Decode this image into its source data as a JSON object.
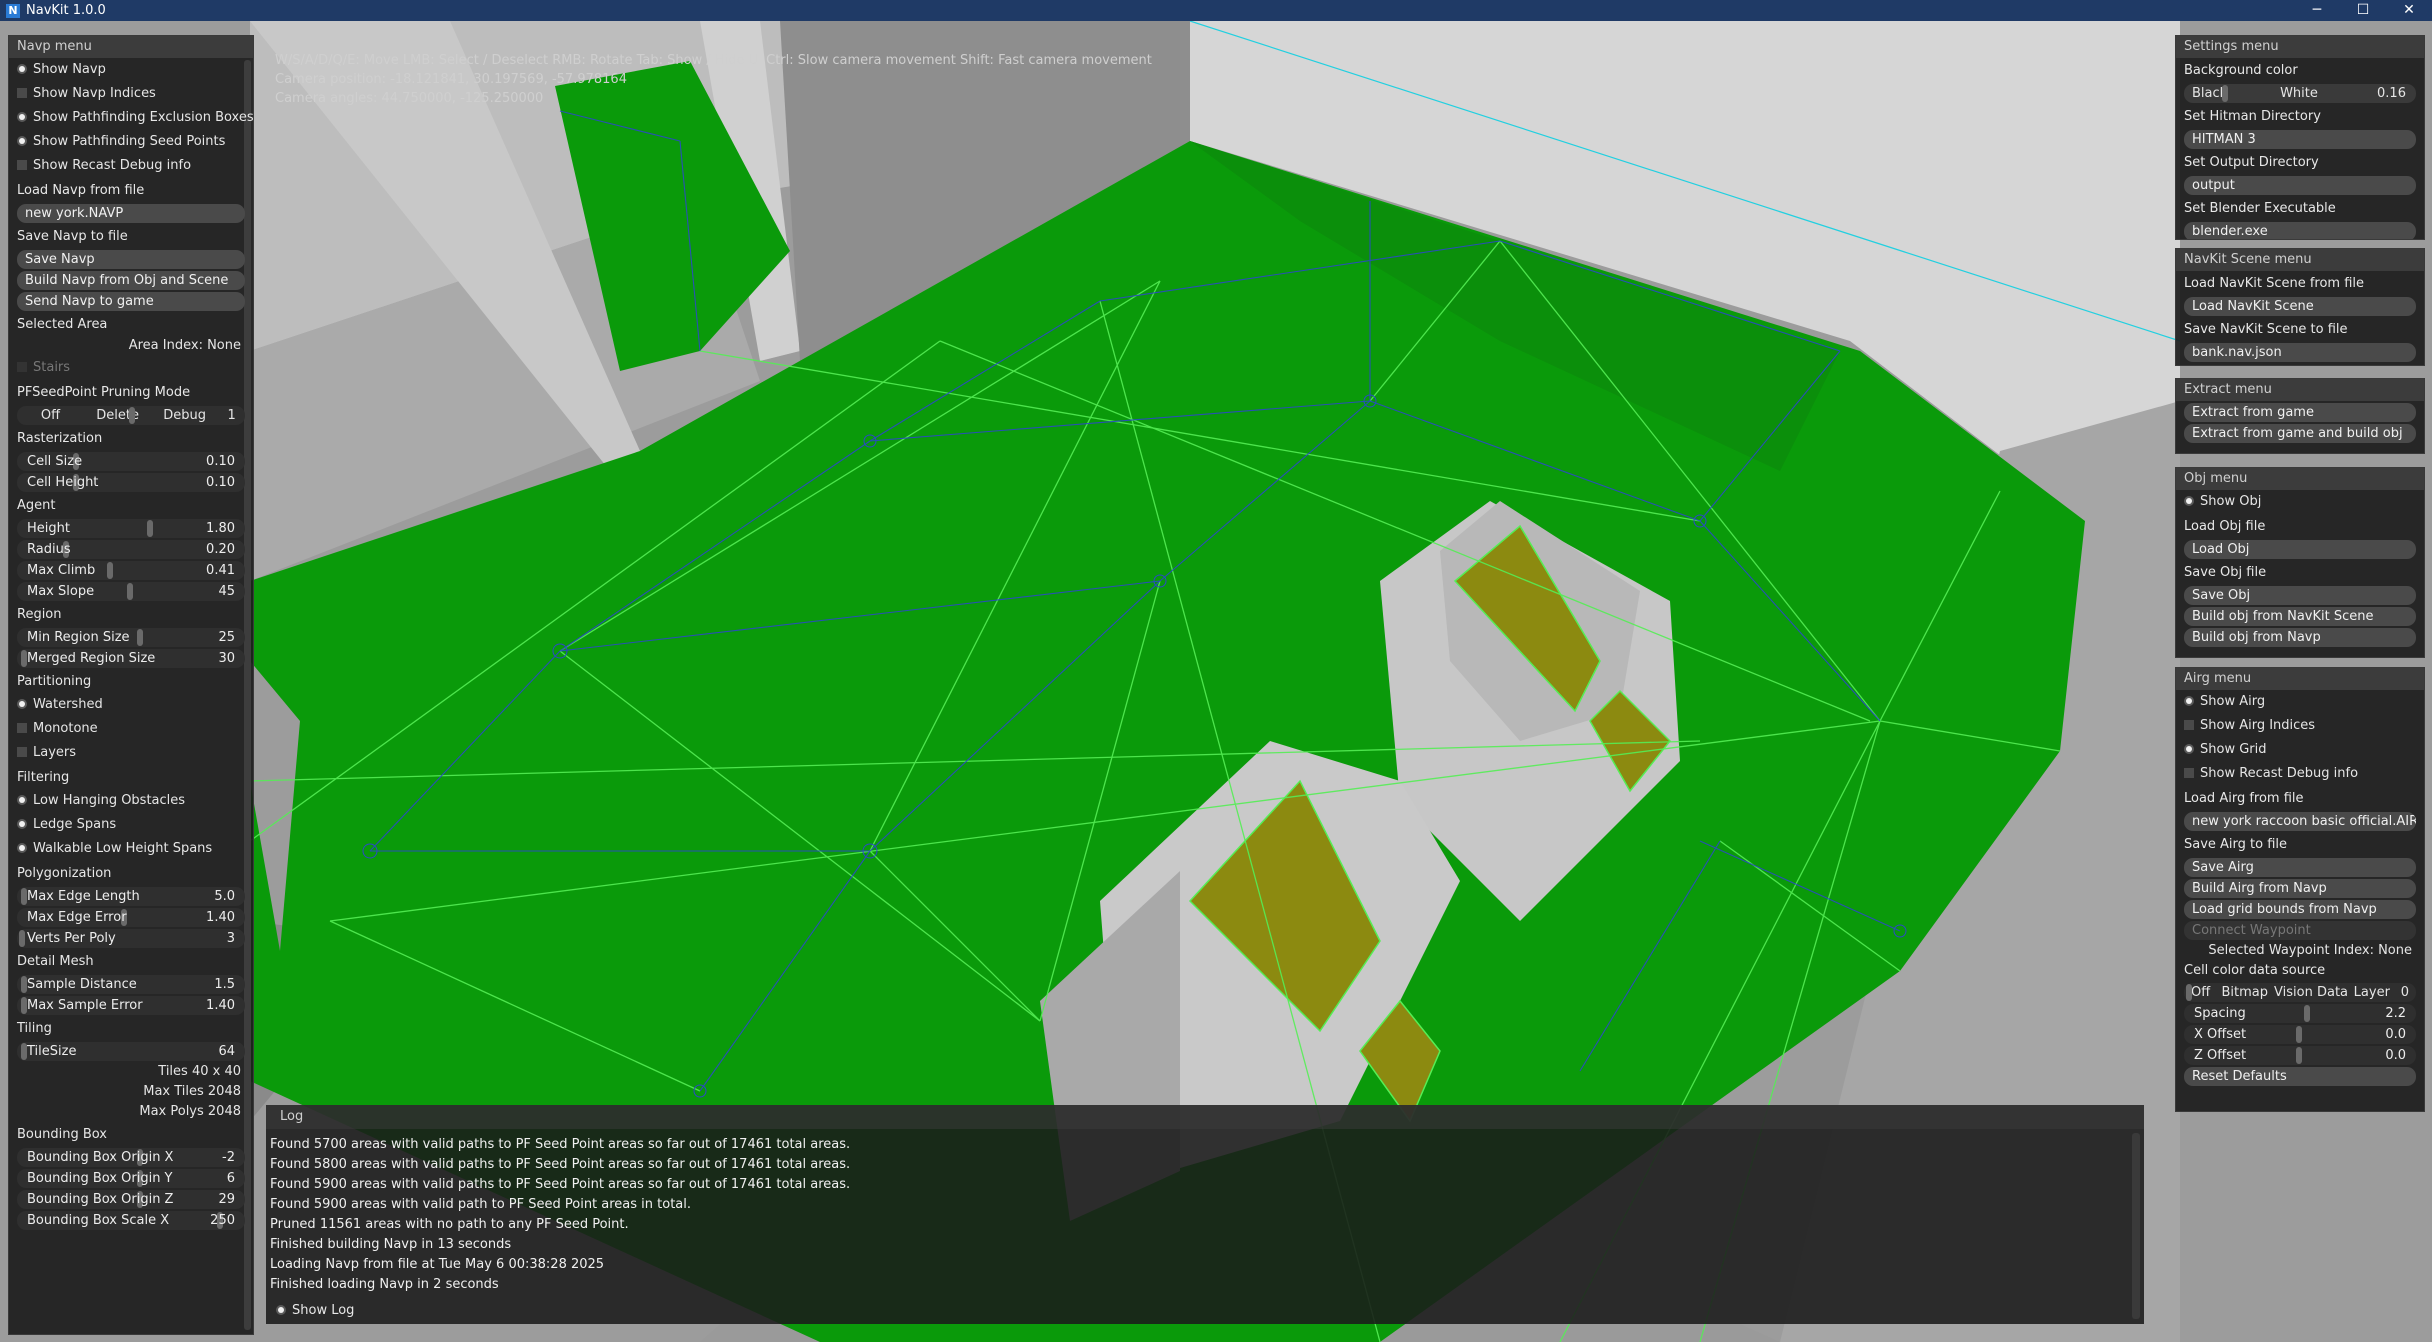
{
  "app": {
    "title": "NavKit 1.0.0",
    "logo_letter": "N"
  },
  "window_controls": {
    "minimize": "─",
    "maximize": "☐",
    "close": "✕"
  },
  "hud": {
    "controls": "W/S/A/D/Q/E: Move  LMB: Select / Deselect  RMB: Rotate  Tab: Show / Hide UI  Ctrl: Slow camera movement  Shift: Fast camera movement",
    "camera_position": "Camera position: -18.121841, 30.197569, -57.978164",
    "camera_angles": "Camera angles: 44.750000, -125.250000"
  },
  "navp_menu": {
    "title": "Navp menu",
    "show_navp": "Show Navp",
    "show_navp_indices": "Show Navp Indices",
    "show_exclusion": "Show Pathfinding Exclusion Boxes",
    "show_seed": "Show Pathfinding Seed Points",
    "show_recast": "Show Recast Debug info",
    "load_label": "Load Navp from file",
    "load_value": "new york.NAVP",
    "save_label": "Save Navp to file",
    "save_btn": "Save Navp",
    "build_btn": "Build Navp from Obj and Scene",
    "send_btn": "Send Navp to game",
    "selected_area": "Selected Area",
    "area_index": "Area Index: None",
    "stairs": "Stairs",
    "pruning_label": "PFSeedPoint Pruning Mode",
    "pruning_opts": [
      "Off",
      "Delete",
      "Debug",
      "1"
    ],
    "rasterization": "Rasterization",
    "cell_size": {
      "label": "Cell Size",
      "value": "0.10"
    },
    "cell_height": {
      "label": "Cell Height",
      "value": "0.10"
    },
    "agent": "Agent",
    "height": {
      "label": "Height",
      "value": "1.80"
    },
    "radius": {
      "label": "Radius",
      "value": "0.20"
    },
    "max_climb": {
      "label": "Max Climb",
      "value": "0.41"
    },
    "max_slope": {
      "label": "Max Slope",
      "value": "45"
    },
    "region": "Region",
    "min_region": {
      "label": "Min Region Size",
      "value": "25"
    },
    "merged_region": {
      "label": "Merged Region Size",
      "value": "30"
    },
    "partitioning": "Partitioning",
    "watershed": "Watershed",
    "monotone": "Monotone",
    "layers": "Layers",
    "filtering": "Filtering",
    "low_hanging": "Low Hanging Obstacles",
    "ledge_spans": "Ledge Spans",
    "walkable_low": "Walkable Low Height Spans",
    "polygonization": "Polygonization",
    "max_edge_len": {
      "label": "Max Edge Length",
      "value": "5.0"
    },
    "max_edge_err": {
      "label": "Max Edge Error",
      "value": "1.40"
    },
    "verts_per_poly": {
      "label": "Verts Per Poly",
      "value": "3"
    },
    "detail_mesh": "Detail Mesh",
    "sample_distance": {
      "label": "Sample Distance",
      "value": "1.5"
    },
    "max_sample_error": {
      "label": "Max Sample Error",
      "value": "1.40"
    },
    "tiling": "Tiling",
    "tile_size": {
      "label": "TileSize",
      "value": "64"
    },
    "tiles": "Tiles  40 x 40",
    "max_tiles": "Max Tiles  2048",
    "max_polys": "Max Polys  2048",
    "bounding_box": "Bounding Box",
    "bb_origin_x": {
      "label": "Bounding Box Origin X",
      "value": "-2"
    },
    "bb_origin_y": {
      "label": "Bounding Box Origin Y",
      "value": "6"
    },
    "bb_origin_z": {
      "label": "Bounding Box Origin Z",
      "value": "29"
    },
    "bb_scale_x": {
      "label": "Bounding Box Scale X",
      "value": "250"
    }
  },
  "settings_menu": {
    "title": "Settings menu",
    "bg_label": "Background color",
    "bg_black": "Black",
    "bg_white": "White",
    "bg_value": "0.16",
    "hitman_label": "Set Hitman Directory",
    "hitman_value": "HITMAN 3",
    "output_label": "Set Output Directory",
    "output_value": "output",
    "blender_label": "Set Blender Executable",
    "blender_value": "blender.exe"
  },
  "scene_menu": {
    "title": "NavKit Scene menu",
    "load_label": "Load NavKit Scene from file",
    "load_btn": "Load NavKit Scene",
    "save_label": "Save NavKit Scene to file",
    "save_value": "bank.nav.json"
  },
  "extract_menu": {
    "title": "Extract menu",
    "extract_btn": "Extract from game",
    "extract_build_btn": "Extract from game and build obj"
  },
  "obj_menu": {
    "title": "Obj menu",
    "show_obj": "Show Obj",
    "load_label": "Load Obj file",
    "load_btn": "Load Obj",
    "save_label": "Save Obj file",
    "save_btn": "Save Obj",
    "build_scene_btn": "Build obj from NavKit Scene",
    "build_navp_btn": "Build obj from Navp"
  },
  "airg_menu": {
    "title": "Airg menu",
    "show_airg": "Show Airg",
    "show_airg_indices": "Show Airg Indices",
    "show_grid": "Show Grid",
    "show_recast": "Show Recast Debug info",
    "load_label": "Load Airg from file",
    "load_value": "new york raccoon basic official.AIRG",
    "save_label": "Save Airg to file",
    "save_btn": "Save Airg",
    "build_btn": "Build Airg from Navp",
    "grid_bounds_btn": "Load grid bounds from Navp",
    "connect_btn": "Connect Waypoint",
    "selected_waypoint": "Selected Waypoint Index: None",
    "cell_color_label": "Cell color data source",
    "cell_color_opts": [
      "Off",
      "Bitmap",
      "Vision Data",
      "Layer",
      "0"
    ],
    "spacing": {
      "label": "Spacing",
      "value": "2.2"
    },
    "x_offset": {
      "label": "X Offset",
      "value": "0.0"
    },
    "z_offset": {
      "label": "Z Offset",
      "value": "0.0"
    },
    "reset_btn": "Reset Defaults"
  },
  "log": {
    "title": "Log",
    "lines": [
      "Found 5700 areas with valid paths to PF Seed Point areas so far out of 17461 total areas.",
      "Found 5800 areas with valid paths to PF Seed Point areas so far out of 17461 total areas.",
      "Found 5900 areas with valid paths to PF Seed Point areas so far out of 17461 total areas.",
      "Found 5900 areas with valid path to PF Seed Point areas in total.",
      "Pruned 11561 areas with no path to any PF Seed Point.",
      "Finished building Navp in 13 seconds",
      "Loading Navp from file at Tue May  6 00:38:28 2025",
      "Finished loading Navp in 2 seconds"
    ],
    "show_log": "Show Log"
  },
  "colors": {
    "navmesh": "#0a9a0a",
    "edge_green": "#55ee55",
    "edge_blue": "#2040c0",
    "stairs_olive": "#8c8a10",
    "geometry": "#b4b4b4",
    "panel_bg": "#1c1c1c"
  }
}
